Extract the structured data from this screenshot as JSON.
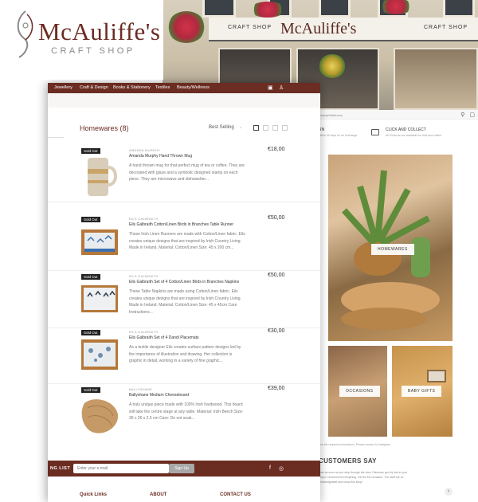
{
  "brand": {
    "name": "McAuliffe's",
    "sub": "CRAFT SHOP"
  },
  "storefront": {
    "sign_left": "CRAFT SHOP",
    "sign_name": "McAuliffe's",
    "sign_right": "CRAFT SHOP"
  },
  "nav": {
    "items": [
      "Jewellery",
      "Craft & Design",
      "Books & Stationery",
      "Textiles",
      "Beauty/Wellness"
    ],
    "cart_icon": "bag-icon",
    "user_icon": "user-icon"
  },
  "listing": {
    "title": "Homewares (8)",
    "sort_value": "Best Selling",
    "view_modes": [
      "list-view-icon",
      "grid-view-icon",
      "grid-large-view-icon",
      "grid-xl-view-icon"
    ]
  },
  "products": [
    {
      "sold_out": "Sold Out",
      "brand": "AMANDA MURPHY",
      "name": "Amanda Murphy Hand Thrown Mug",
      "price": "€18,00",
      "desc": "A hand thrown mug for that perfect mug of tea or coffee. They are decorated with glaze and a symbolic designed stamp on each piece. They are microwave and dishwasher..."
    },
    {
      "sold_out": "Sold Out",
      "brand": "EILS GALBRAITH",
      "name": "Eils Galbraith Cotton/Linen Birds in Branches Table Runner",
      "price": "€50,00",
      "desc": "These Irish Linen Runners are made with Cotton/Linen fabric. Eils creates unique designs that are inspired by Irish Country Living. Made in Ireland. Material: Cotton/Linen Size: 45 x 200 cm..."
    },
    {
      "sold_out": "Sold Out",
      "brand": "EILS GALBRAITH",
      "name": "Eils Galbraith Set of 4 Cotton/Linen Birds in Branches Napkins",
      "price": "€50,00",
      "desc": "These Table Napkins are made using Cotton/Linen fabric. Eils creates unique designs that are inspired by Irish Country Living. Made in Ireland. Material: Cotton/Linen Size: 45 x 45cm Care Instructions..."
    },
    {
      "sold_out": "Sold Out",
      "brand": "EILS GALBRAITH",
      "name": "Eils Galbraith Set of 4 Dandi Placemats",
      "price": "€30,00",
      "desc": "As a textile designer Eils creates surface pattern designs led by the importance of illustration and drawing. Her collection is graphic in detail, working in a variety of fine graphic..."
    },
    {
      "sold_out": "Sold Out",
      "brand": "BALLYSHANE",
      "name": "Ballyshane Medium Cheeseboard",
      "price": "€39,00",
      "desc": "A truly unique piece made with 100% Irish hardwood. This board will take the centre stage at any table. Material: Irish Beech Size: 35 x 26 x 2.5 cm Care: Do not soak..."
    }
  ],
  "newsletter": {
    "label": "NG LIST",
    "placeholder": "Enter your e-mail",
    "button": "Sign Up",
    "facebook_icon": "facebook-icon",
    "instagram_icon": "instagram-icon"
  },
  "footer": {
    "quick_links": "Quick Links",
    "about": "ABOUT",
    "contact": "CONTACT US"
  },
  "home": {
    "breadcrumb": "Beauty/Wellness",
    "usp_left_title": "RN",
    "usp_left_sub": "within 30 days for an exchange.",
    "usp_right_title": "CLICK AND COLLECT",
    "usp_right_sub": "All Products are available for click and collect",
    "tiles": {
      "homewares": "HOMEWARES",
      "occasions": "OCCASIONS",
      "baby": "BABY GIFTS"
    },
    "permission": "ave the required permissions. Please contact to Instagram",
    "customers_say": "CUSTOMERS SAY",
    "testimonial": "ome as soon as you step through the door. Fabulous ged by lots in your shop! I recommend everything. Get for the occasion. The staff are so knowledgeable and show this shop!",
    "arrow": "›"
  }
}
